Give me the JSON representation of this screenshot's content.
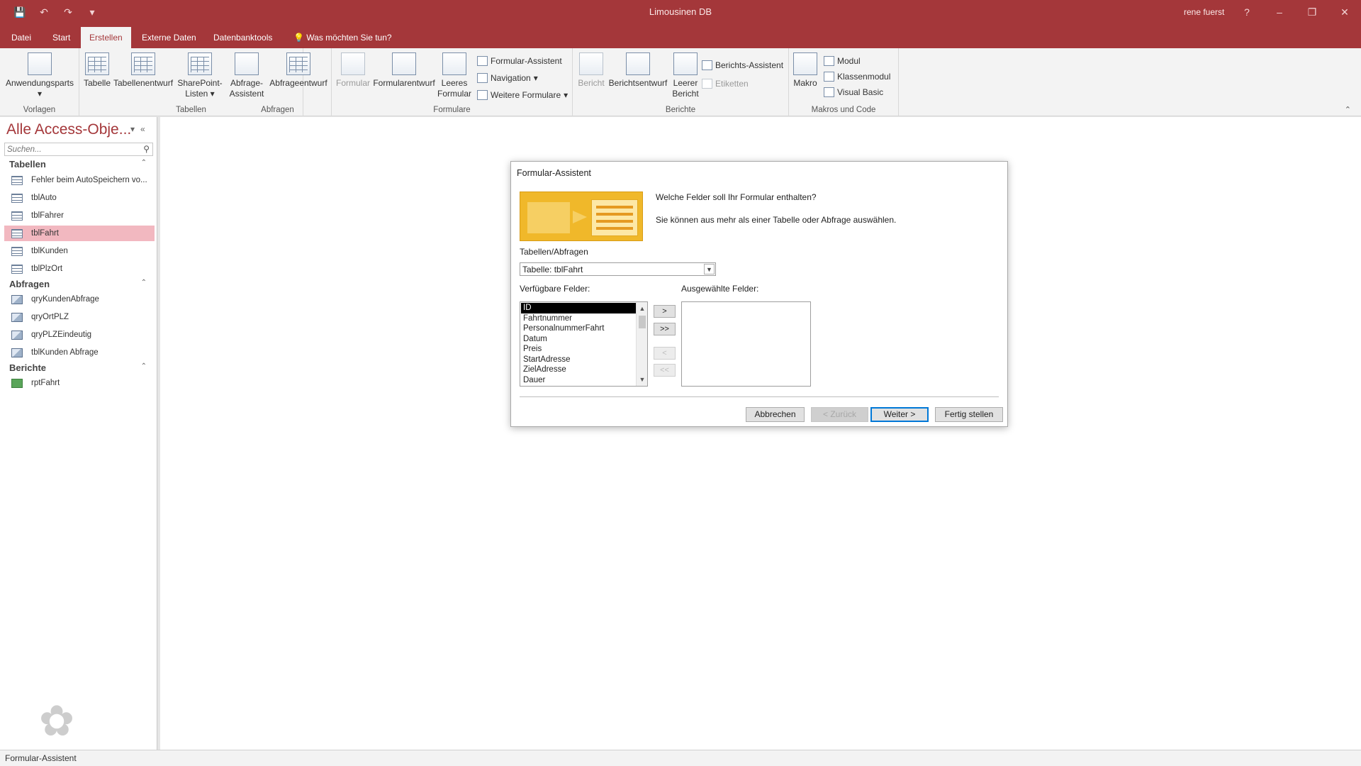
{
  "window": {
    "title": "Limousinen DB",
    "user": "rene fuerst"
  },
  "colors": {
    "accent": "#a4373a",
    "selection": "#f2b8c0",
    "default_button": "#0078d7"
  },
  "qat_icons": [
    "save-icon",
    "undo-icon",
    "redo-icon",
    "customize-icon"
  ],
  "tabs": [
    {
      "label": "Datei"
    },
    {
      "label": "Start"
    },
    {
      "label": "Erstellen",
      "active": true
    },
    {
      "label": "Externe Daten"
    },
    {
      "label": "Datenbanktools"
    },
    {
      "label": "Was möchten Sie tun?"
    }
  ],
  "ribbon": {
    "vorlagen": {
      "label": "Vorlagen",
      "anwendungsparts": "Anwendungsparts"
    },
    "tabellen": {
      "label": "Tabellen",
      "tabelle": "Tabelle",
      "tabellenentwurf": "Tabellenentwurf",
      "sharepoint_1": "SharePoint-",
      "sharepoint_2": "Listen"
    },
    "abfragen": {
      "label": "Abfragen",
      "assistent_1": "Abfrage-",
      "assistent_2": "Assistent",
      "entwurf": "Abfrageentwurf"
    },
    "formulare": {
      "label": "Formulare",
      "formular": "Formular",
      "formularentwurf": "Formularentwurf",
      "leeres_1": "Leeres",
      "leeres_2": "Formular",
      "formular_assistent": "Formular-Assistent",
      "navigation": "Navigation",
      "weitere": "Weitere Formulare"
    },
    "berichte": {
      "label": "Berichte",
      "bericht": "Bericht",
      "berichtsentwurf": "Berichtsentwurf",
      "leerer_1": "Leerer",
      "leerer_2": "Bericht",
      "berichts_assistent": "Berichts-Assistent",
      "etiketten": "Etiketten"
    },
    "makros": {
      "label": "Makros und Code",
      "makro": "Makro",
      "modul": "Modul",
      "klassenmodul": "Klassenmodul",
      "visual_basic": "Visual Basic"
    }
  },
  "nav": {
    "title": "Alle Access-Obje...",
    "search_placeholder": "Suchen...",
    "sections": [
      {
        "label": "Tabellen",
        "items": [
          {
            "label": "Fehler beim AutoSpeichern vo...",
            "type": "table"
          },
          {
            "label": "tblAuto",
            "type": "table"
          },
          {
            "label": "tblFahrer",
            "type": "table"
          },
          {
            "label": "tblFahrt",
            "type": "table",
            "selected": true
          },
          {
            "label": "tblKunden",
            "type": "table"
          },
          {
            "label": "tblPlzOrt",
            "type": "table"
          }
        ]
      },
      {
        "label": "Abfragen",
        "items": [
          {
            "label": "qryKundenAbfrage",
            "type": "query"
          },
          {
            "label": "qryOrtPLZ",
            "type": "query"
          },
          {
            "label": "qryPLZEindeutig",
            "type": "query"
          },
          {
            "label": "tblKunden Abfrage",
            "type": "query"
          }
        ]
      },
      {
        "label": "Berichte",
        "items": [
          {
            "label": "rptFahrt",
            "type": "report"
          }
        ]
      }
    ]
  },
  "dialog": {
    "title": "Formular-Assistent",
    "question": "Welche Felder soll Ihr Formular enthalten?",
    "hint": "Sie können aus mehr als einer Tabelle oder Abfrage auswählen.",
    "tables_label": "Tabellen/Abfragen",
    "tables_value": "Tabelle: tblFahrt",
    "available_label": "Verfügbare Felder:",
    "selected_label": "Ausgewählte Felder:",
    "available_fields": [
      "ID",
      "Fahrtnummer",
      "PersonalnummerFahrt",
      "Datum",
      "Preis",
      "StartAdresse",
      "ZielAdresse",
      "Dauer"
    ],
    "selected_index": 0,
    "move_buttons": [
      {
        "label": ">",
        "enabled": true
      },
      {
        "label": ">>",
        "enabled": true
      },
      {
        "label": "<",
        "enabled": false
      },
      {
        "label": "<<",
        "enabled": false
      }
    ],
    "buttons": {
      "cancel": "Abbrechen",
      "back": "< Zurück",
      "next": "Weiter >",
      "finish": "Fertig stellen"
    }
  },
  "status": {
    "text": "Formular-Assistent"
  }
}
